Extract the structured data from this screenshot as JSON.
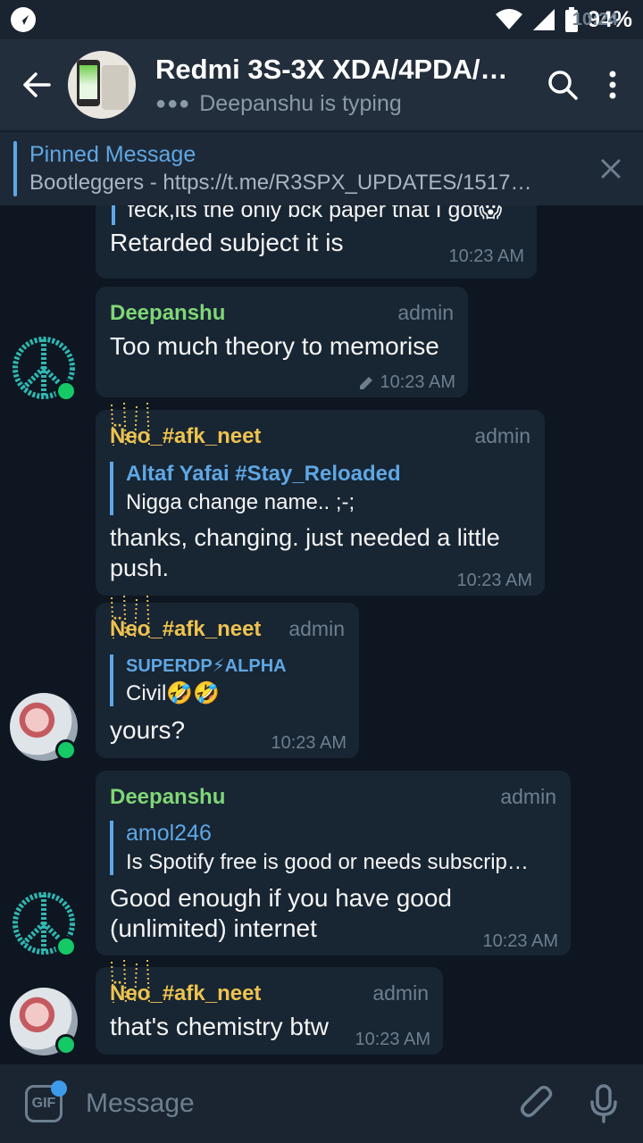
{
  "statusbar": {
    "time": "10:24",
    "battery": "94%"
  },
  "header": {
    "title": "Redmi 3S-3X XDA/4PDA/…",
    "status": "Deepanshu is typing",
    "icons": [
      "back-arrow-icon",
      "search-icon",
      "more-vert-icon"
    ]
  },
  "pinned": {
    "title": "Pinned Message",
    "text": "Bootleggers - https://t.me/R3SPX_UPDATES/1517…"
  },
  "messages": [
    {
      "line1": "feck,its the only bck paper that I got😱",
      "line2": "Retarded subject it is",
      "time": "10:23 AM"
    },
    {
      "sender": "Deepanshu",
      "role": "admin",
      "text": "Too much theory to memorise",
      "time": "10:23 AM",
      "edited": true
    },
    {
      "sender": "N̈eo_#afk_neet",
      "role": "admin",
      "reply_name": "Altaf Yafai #Stay_Reloaded",
      "reply_text": "Nigga change name.. ;-;",
      "line1": "thanks, changing. just needed a little",
      "line2": "push.",
      "time": "10:23 AM"
    },
    {
      "sender": "N̈eo_#afk_neet",
      "role": "admin",
      "reply_name": "SUPERDP⚡ALPHA",
      "reply_text": "Civil🤣🤣",
      "text": "yours?",
      "time": "10:23 AM"
    },
    {
      "sender": "Deepanshu",
      "role": "admin",
      "reply_name": "amol246",
      "reply_text": "Is Spotify free is good or needs subscrip…",
      "line1": "Good enough if you have good",
      "line2": "(unlimited) internet",
      "time": "10:23 AM"
    },
    {
      "sender": "N̈eo_#afk_neet",
      "role": "admin",
      "text": "that's chemistry btw",
      "time": "10:23 AM"
    }
  ],
  "input": {
    "placeholder": "Message",
    "gif_label": "GIF"
  },
  "colors": {
    "bg": "#0e1621",
    "bubble": "#182533",
    "accent": "#5fa7e4",
    "online": "#14c966"
  }
}
